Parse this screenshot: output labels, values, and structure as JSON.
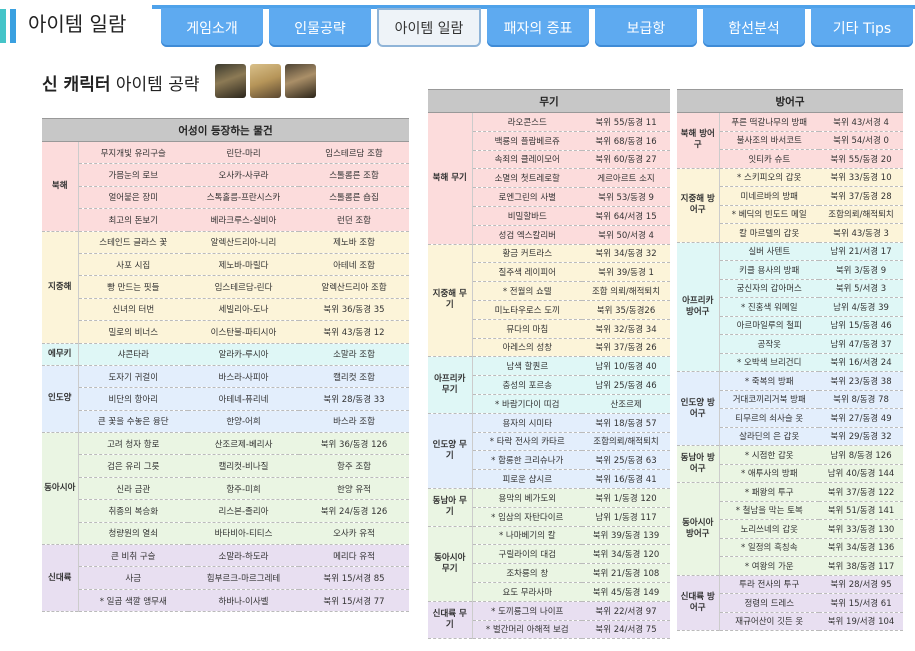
{
  "header": {
    "title": "아이템 일람",
    "tabs": [
      {
        "label": "게임소개",
        "active": false
      },
      {
        "label": "인물공략",
        "active": false
      },
      {
        "label": "아이템 일람",
        "active": true
      },
      {
        "label": "패자의 증표",
        "active": false
      },
      {
        "label": "보급항",
        "active": false
      },
      {
        "label": "함선분석",
        "active": false
      },
      {
        "label": "기타 Tips",
        "active": false
      }
    ]
  },
  "section": {
    "title_bold": "신 캐릭터",
    "title_rest": " 아이템 공략"
  },
  "left_table": {
    "title": "어성이 등장하는 물건",
    "groups": [
      {
        "cat": "북해",
        "color": "pink",
        "rows": [
          [
            "무지개빛 유리구슬",
            "린단-마리",
            "임스테르담 조합"
          ],
          [
            "가믐눈의 로브",
            "오사카-사쿠라",
            "스톨롬른 조합"
          ],
          [
            "얼어붙은 장미",
            "스톡홀름-프란시스카",
            "스톨롬른 숍집"
          ],
          [
            "최고의 돈보기",
            "베라크루스-실비아",
            "런던 조합"
          ]
        ]
      },
      {
        "cat": "지중해",
        "color": "yellow",
        "rows": [
          [
            "스테인드 글라스 꽃",
            "알렉산드리아-니리",
            "제노바 조합"
          ],
          [
            "사포 시집",
            "제노바-마릴다",
            "아테네 조합"
          ],
          [
            "빵 만드는 핏들",
            "임스테르담-린다",
            "알렉산드리아 조합"
          ],
          [
            "신녀의 터번",
            "세빌리아-도나",
            "북위 36/동경 35"
          ],
          [
            "밀로의 비너스",
            "이스탄불-파티시아",
            "북위 43/동경 12"
          ]
        ]
      },
      {
        "cat": "에무키",
        "color": "cyan",
        "rows": [
          [
            "샤콘타라",
            "알라카-루시아",
            "소말라 조합"
          ]
        ]
      },
      {
        "cat": "인도양",
        "color": "blue",
        "rows": [
          [
            "도자기 귀걸이",
            "바스라-사피아",
            "캘리컷 조합"
          ],
          [
            "비단의 항아리",
            "아테네-퓨리네",
            "북위 28/동경 33"
          ],
          [
            "큰 꽃을 수놓은 융단",
            "한양-어희",
            "바스라 조합"
          ]
        ]
      },
      {
        "cat": "동아시아",
        "color": "green",
        "rows": [
          [
            "고려 청자 항로",
            "산조르제-베리사",
            "북위 36/동경 126"
          ],
          [
            "검은 유리 그릇",
            "캘리컷-비나질",
            "항주 조합"
          ],
          [
            "신라 금관",
            "항주-미희",
            "한양 유적"
          ],
          [
            "취종의 복승화",
            "리스본-졸리아",
            "북위 24/동경 126"
          ],
          [
            "청량원의 열쇠",
            "바타비아-티티스",
            "오사카 유적"
          ]
        ]
      },
      {
        "cat": "신대륙",
        "color": "lav",
        "rows": [
          [
            "큰 비취 구슬",
            "소말라-하도라",
            "메리다 유적"
          ],
          [
            "사금",
            "힘부르크-마르그레테",
            "북위 15/서경 85"
          ],
          [
            "* 일곱 색깔 앵무새",
            "하바나-이사벨",
            "북위 15/서경 77"
          ]
        ]
      }
    ]
  },
  "mid_table": {
    "title": "무기",
    "groups": [
      {
        "cat": "북해 무기",
        "color": "pink",
        "rows": [
          [
            "라오콘스드",
            "북위 55/동경 11"
          ],
          [
            "백룡의 플람베르쥬",
            "북위 68/동경 16"
          ],
          [
            "속죄의 클레이모어",
            "북위 60/동경 27"
          ],
          [
            "소멸의 첫트레로할",
            "게르아르트 소지"
          ],
          [
            "로엔그린의 사별",
            "북위 53/동경 9"
          ],
          [
            "비밀할바드",
            "북위 64/서경 15"
          ],
          [
            "성검 엑스칼리버",
            "북위 50/서경 4"
          ]
        ]
      },
      {
        "cat": "지중해 무기",
        "color": "yellow",
        "rows": [
          [
            "황금 커트라스",
            "북위 34/동경 32"
          ],
          [
            "질주색 레이피어",
            "북위 39/동경 1"
          ],
          [
            "* 전월의 쇼텔",
            "조합 의뢰/해적퇴치"
          ],
          [
            "미노타우로스 도끼",
            "북위 35/동경26"
          ],
          [
            "뮤다의 마침",
            "북위 32/동경 34"
          ],
          [
            "아레스의 성창",
            "북위 37/동경 26"
          ]
        ]
      },
      {
        "cat": "아프리카 무기",
        "color": "cyan",
        "rows": [
          [
            "남색 할퀀르",
            "남위 10/동경 40"
          ],
          [
            "충성의 포르송",
            "남위 25/동경 46"
          ],
          [
            "* 바람기다이 띠검",
            "산조르제"
          ]
        ]
      },
      {
        "cat": "인도양 무기",
        "color": "blue",
        "rows": [
          [
            "용자의 시미타",
            "북위 18/동경 57"
          ],
          [
            "* 타락 전사의 카타르",
            "조합의뢰/해적퇴치"
          ],
          [
            "* 함롱한 크리슈나가",
            "북위 25/동경 63"
          ],
          [
            "피로운 샴시르",
            "북위 16/동경 41"
          ]
        ]
      },
      {
        "cat": "동남아 무기",
        "color": "green",
        "rows": [
          [
            "용막의 베가도외",
            "북위 1/동경 120"
          ],
          [
            "* 임삼의 자탄다이르",
            "남위 1/동경 117"
          ]
        ]
      },
      {
        "cat": "동아시아 무기",
        "color": "green",
        "rows": [
          [
            "* 나마베기의 칼",
            "북위 39/동경 139"
          ],
          [
            "구릴라이의 대검",
            "북위 34/동경 120"
          ],
          [
            "조차룡의 창",
            "북위 21/동경 108"
          ],
          [
            "요도 무라사마",
            "북위 45/동경 149"
          ]
        ]
      },
      {
        "cat": "신대륙 무기",
        "color": "lav",
        "rows": [
          [
            "* 도끼룡그의 나이프",
            "북위 22/서경 97"
          ],
          [
            "* 벌간머리 아해적 보검",
            "북위 24/서경 75"
          ]
        ]
      }
    ]
  },
  "right_table": {
    "title": "방어구",
    "groups": [
      {
        "cat": "북해 방어구",
        "color": "pink",
        "rows": [
          [
            "푸른 떡갈나무의 방패",
            "북위 43/서경 4"
          ],
          [
            "불사조의 바서코트",
            "북위 54/서경 0"
          ],
          [
            "잇티카 슈트",
            "북위 55/동경 20"
          ]
        ]
      },
      {
        "cat": "지중해 방어구",
        "color": "yellow",
        "rows": [
          [
            "* 스키피오의 갑옷",
            "북위 33/동경 10"
          ],
          [
            "미네르바의 방패",
            "북위 37/동경 28"
          ],
          [
            "* 베딕의 빈도드 메일",
            "조합의뢰/해적퇴치"
          ],
          [
            "칼 마르텔의 갑옷",
            "북위 43/동경 3"
          ]
        ]
      },
      {
        "cat": "아프리카 방어구",
        "color": "cyan",
        "rows": [
          [
            "실버 사텐트",
            "남위 21/서경 17"
          ],
          [
            "키클 용사의 방패",
            "북위 3/동경 9"
          ],
          [
            "궁신자의 갑아머스",
            "북위 5/서경 3"
          ],
          [
            "* 진홍색 워메일",
            "남위 4/동경 39"
          ],
          [
            "아르마일루의 철피",
            "남위 15/동경 46"
          ],
          [
            "공작옷",
            "남위 47/동경 37"
          ],
          [
            "* 오박색 브리건디",
            "북위 16/서경 24"
          ]
        ]
      },
      {
        "cat": "인도양 방어구",
        "color": "blue",
        "rows": [
          [
            "* 죽복의 방패",
            "북위 23/동경 38"
          ],
          [
            "거대코끼리거북 방패",
            "북위 8/동경 78"
          ],
          [
            "티무르의 쇠사슬 옷",
            "북위 27/동경 49"
          ],
          [
            "살라딘의 은 갑옷",
            "북위 29/동경 32"
          ]
        ]
      },
      {
        "cat": "동남아 방어구",
        "color": "green",
        "rows": [
          [
            "* 시점한 갑옷",
            "남위 8/동경 126"
          ],
          [
            "* 애투사의 방패",
            "남위 40/동경 144"
          ]
        ]
      },
      {
        "cat": "동아시아 방어구",
        "color": "green",
        "rows": [
          [
            "* 패왕의 투구",
            "북위 37/동경 122"
          ],
          [
            "* 철남을 막는 토복",
            "북위 51/동경 141"
          ],
          [
            "노리쓰네의 갑옷",
            "북위 33/동경 130"
          ],
          [
            "* 일정의 흑칭속",
            "북위 34/동경 136"
          ],
          [
            "* 여왕의 가운",
            "북위 38/동경 117"
          ]
        ]
      },
      {
        "cat": "신대륙 방어구",
        "color": "lav",
        "rows": [
          [
            "투라 전사의 투구",
            "북위 28/서경 95"
          ],
          [
            "정령의 드레스",
            "북위 15/서경 61"
          ],
          [
            "재규어산이 깃든 옷",
            "북위 19/서경 104"
          ]
        ]
      }
    ]
  }
}
